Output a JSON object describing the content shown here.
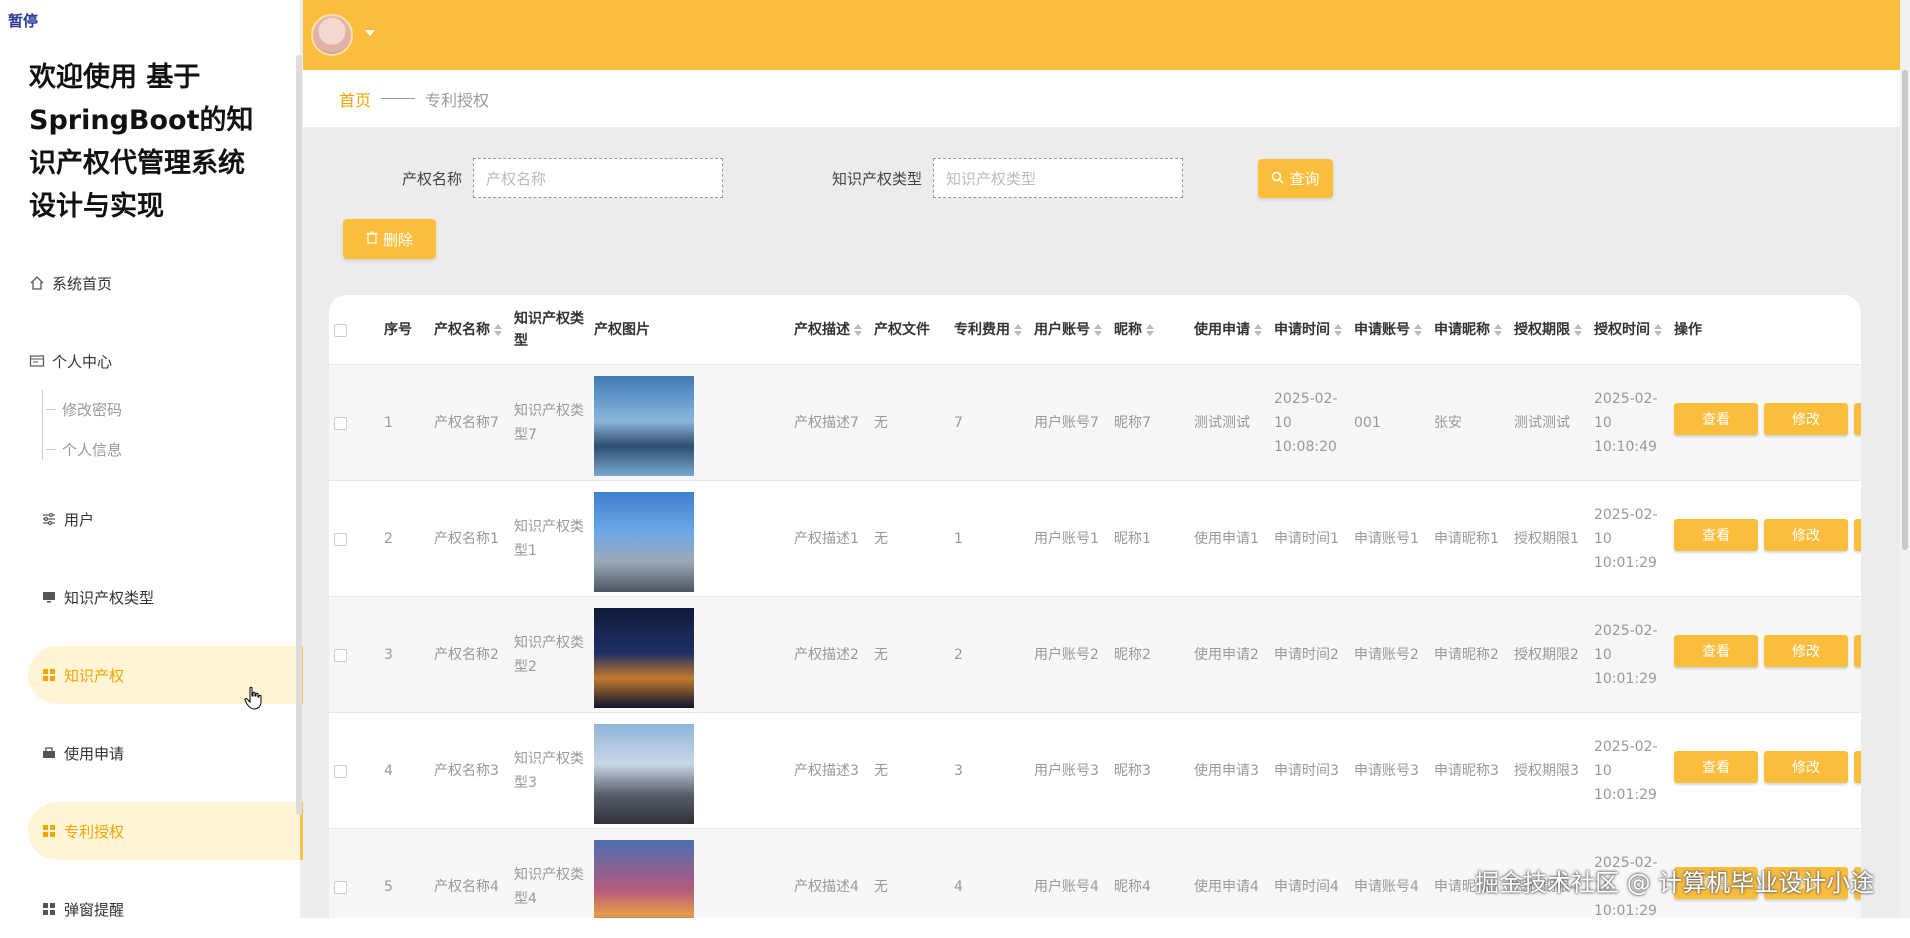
{
  "pause_label": "暂停",
  "sidebar": {
    "title": "欢迎使用 基于SpringBoot的知识产权代管理系统设计与实现",
    "items": [
      {
        "label": "系统首页",
        "icon": "home-icon"
      },
      {
        "label": "个人中心",
        "icon": "id-card-icon"
      },
      {
        "label": "用户",
        "icon": "sliders-icon"
      },
      {
        "label": "知识产权类型",
        "icon": "monitor-icon"
      },
      {
        "label": "知识产权",
        "icon": "grid-icon"
      },
      {
        "label": "使用申请",
        "icon": "case-icon"
      },
      {
        "label": "专利授权",
        "icon": "grid-icon"
      },
      {
        "label": "弹窗提醒",
        "icon": "grid-icon"
      }
    ],
    "sub_items": [
      {
        "label": "修改密码"
      },
      {
        "label": "个人信息"
      }
    ]
  },
  "breadcrumb": {
    "home": "首页",
    "current": "专利授权"
  },
  "search": {
    "name_label": "产权名称",
    "name_placeholder": "产权名称",
    "type_label": "知识产权类型",
    "type_placeholder": "知识产权类型",
    "query_label": "查询",
    "delete_label": "删除"
  },
  "table": {
    "headers": {
      "index": "序号",
      "name": "产权名称",
      "type": "知识产权类型",
      "image": "产权图片",
      "desc": "产权描述",
      "file": "产权文件",
      "fee": "专利费用",
      "account": "用户账号",
      "nick": "昵称",
      "apply": "使用申请",
      "apply_time": "申请时间",
      "apply_account": "申请账号",
      "apply_nick": "申请昵称",
      "period": "授权期限",
      "grant_time": "授权时间",
      "ops": "操作"
    },
    "view_label": "查看",
    "edit_label": "修改",
    "rows": [
      {
        "index": "1",
        "name": "产权名称7",
        "type": "知识产权类型7",
        "desc": "产权描述7",
        "file": "无",
        "fee": "7",
        "account": "用户账号7",
        "nick": "昵称7",
        "apply": "测试测试",
        "apply_time": "2025-02-10 10:08:20",
        "apply_account": "001",
        "apply_nick": "张安",
        "period": "测试测试",
        "grant_time": "2025-02-10 10:10:49"
      },
      {
        "index": "2",
        "name": "产权名称1",
        "type": "知识产权类型1",
        "desc": "产权描述1",
        "file": "无",
        "fee": "1",
        "account": "用户账号1",
        "nick": "昵称1",
        "apply": "使用申请1",
        "apply_time": "申请时间1",
        "apply_account": "申请账号1",
        "apply_nick": "申请昵称1",
        "period": "授权期限1",
        "grant_time": "2025-02-10 10:01:29"
      },
      {
        "index": "3",
        "name": "产权名称2",
        "type": "知识产权类型2",
        "desc": "产权描述2",
        "file": "无",
        "fee": "2",
        "account": "用户账号2",
        "nick": "昵称2",
        "apply": "使用申请2",
        "apply_time": "申请时间2",
        "apply_account": "申请账号2",
        "apply_nick": "申请昵称2",
        "period": "授权期限2",
        "grant_time": "2025-02-10 10:01:29"
      },
      {
        "index": "4",
        "name": "产权名称3",
        "type": "知识产权类型3",
        "desc": "产权描述3",
        "file": "无",
        "fee": "3",
        "account": "用户账号3",
        "nick": "昵称3",
        "apply": "使用申请3",
        "apply_time": "申请时间3",
        "apply_account": "申请账号3",
        "apply_nick": "申请昵称3",
        "period": "授权期限3",
        "grant_time": "2025-02-10 10:01:29"
      },
      {
        "index": "5",
        "name": "产权名称4",
        "type": "知识产权类型4",
        "desc": "产权描述4",
        "file": "无",
        "fee": "4",
        "account": "用户账号4",
        "nick": "昵称4",
        "apply": "使用申请4",
        "apply_time": "申请时间4",
        "apply_account": "申请账号4",
        "apply_nick": "申请昵称4",
        "period": "授权期限4",
        "grant_time": "2025-02-10 10:01:29"
      }
    ]
  },
  "watermark": "掘金技术社区 @ 计算机毕业设计小途",
  "colors": {
    "accent": "#fbbd3c",
    "active_bg": "#fff5d6",
    "active_text": "#f0a500"
  }
}
